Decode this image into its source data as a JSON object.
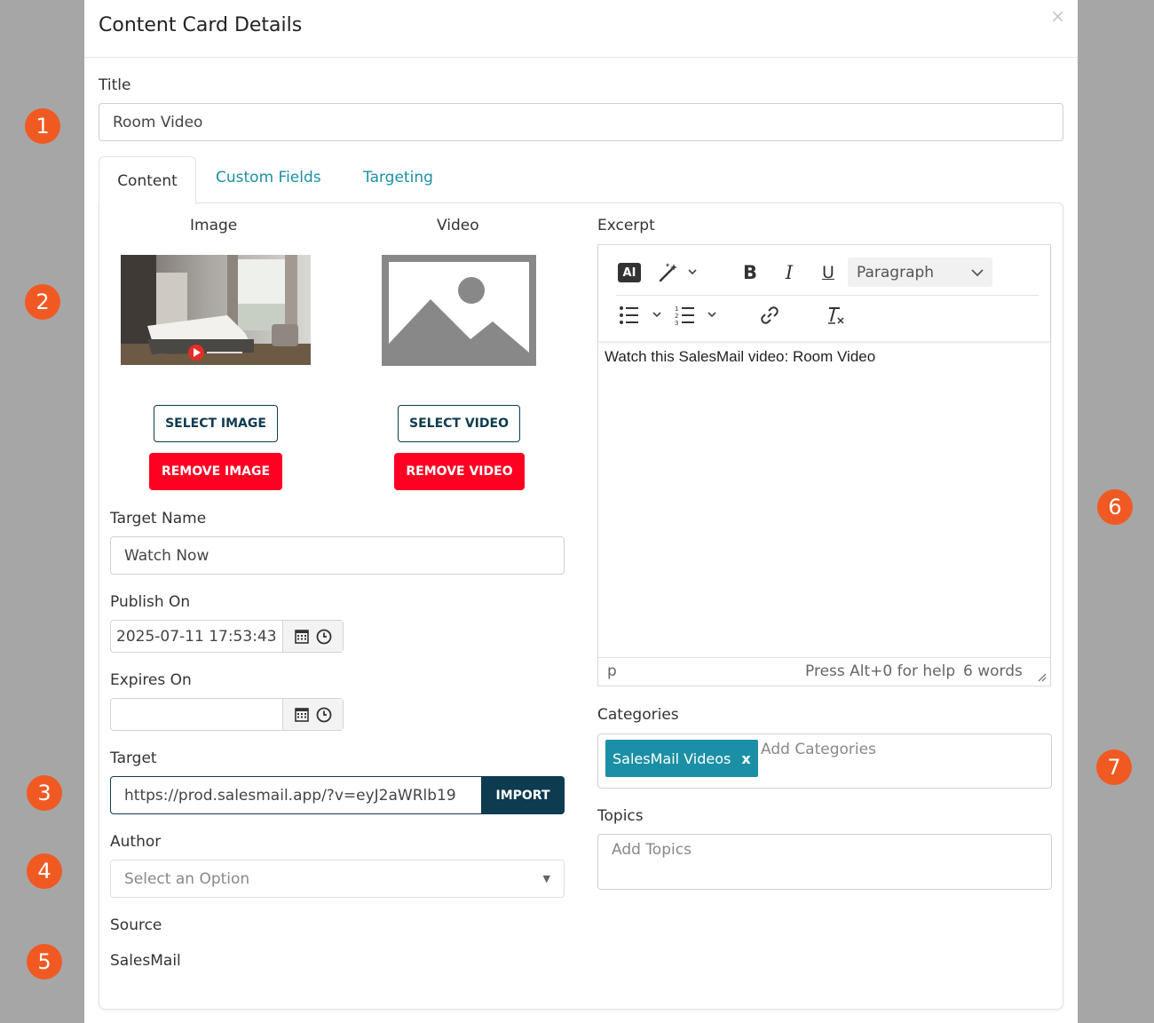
{
  "modal": {
    "title": "Content Card Details",
    "close": "×"
  },
  "title_field": {
    "label": "Title",
    "value": "Room Video"
  },
  "tabs": [
    {
      "label": "Content"
    },
    {
      "label": "Custom Fields"
    },
    {
      "label": "Targeting"
    }
  ],
  "media": {
    "image_label": "Image",
    "video_label": "Video",
    "select_image": "SELECT IMAGE",
    "remove_image": "REMOVE IMAGE",
    "select_video": "SELECT VIDEO",
    "remove_video": "REMOVE VIDEO"
  },
  "target_name": {
    "label": "Target Name",
    "value": "Watch Now"
  },
  "publish_on": {
    "label": "Publish On",
    "value": "2025-07-11 17:53:43"
  },
  "expires_on": {
    "label": "Expires On",
    "value": ""
  },
  "target": {
    "label": "Target",
    "value": "https://prod.salesmail.app/?v=eyJ2aWRlb19",
    "import": "IMPORT"
  },
  "author": {
    "label": "Author",
    "placeholder": "Select an Option"
  },
  "source": {
    "label": "Source",
    "value": "SalesMail"
  },
  "excerpt": {
    "label": "Excerpt",
    "ai": "AI",
    "block_format": "Paragraph",
    "content": "Watch this SalesMail video: Room Video",
    "status_path": "p",
    "status_help": "Press Alt+0 for help",
    "status_words": "6 words"
  },
  "categories": {
    "label": "Categories",
    "tags": [
      {
        "label": "SalesMail Videos",
        "remove": "x"
      }
    ],
    "placeholder": "Add Categories"
  },
  "topics": {
    "label": "Topics",
    "placeholder": "Add Topics"
  },
  "badges": [
    "1",
    "2",
    "3",
    "4",
    "5",
    "6",
    "7"
  ],
  "colors": {
    "accent": "#1b8fa6",
    "danger": "#ff0022",
    "dark": "#0d3b4f",
    "badge": "#f05a22"
  }
}
